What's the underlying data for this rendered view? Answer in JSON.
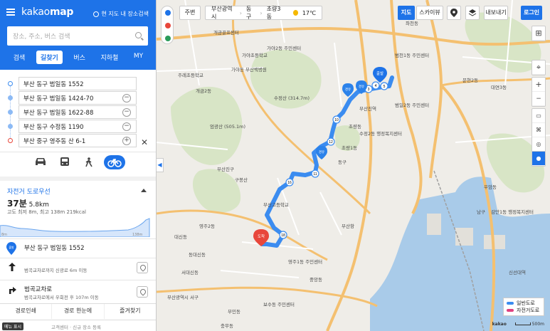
{
  "app": {
    "logo_prefix": "kakao",
    "logo_suffix": "map",
    "search_here": "현 지도 내 장소검색"
  },
  "search": {
    "placeholder": "장소, 주소, 버스 검색"
  },
  "tabs": [
    {
      "label": "검색",
      "active": false
    },
    {
      "label": "길찾기",
      "active": true
    },
    {
      "label": "버스",
      "active": false
    },
    {
      "label": "지하철",
      "active": false
    },
    {
      "label": "MY",
      "active": false
    }
  ],
  "waypoints": [
    {
      "label": "부산 동구 범일동 1552",
      "type": "start"
    },
    {
      "label": "부산 동구 범일동 1424-70",
      "type": "mid"
    },
    {
      "label": "부산 동구 범일동 1622-88",
      "type": "mid"
    },
    {
      "label": "부산 동구 수정동 1190",
      "type": "mid"
    },
    {
      "label": "부산 중구 영주동 산 6-1",
      "type": "end"
    }
  ],
  "waypoint_remove": "−",
  "waypoint_add": "+",
  "close_symbol": "✕",
  "modes": [
    {
      "name": "car",
      "active": false
    },
    {
      "name": "bus",
      "active": false
    },
    {
      "name": "walk",
      "active": false
    },
    {
      "name": "bike",
      "active": true
    }
  ],
  "route": {
    "title": "자전거 도로우선",
    "time_value": "37",
    "time_unit": "분",
    "distance": "5.8km",
    "meta": "고도 최저 8m, 최고 138m  219kcal",
    "elev_min_label": "8m",
    "elev_max_label": "138m"
  },
  "steps": [
    {
      "badge": "출발",
      "title": "부산 동구 범일동 1552",
      "sub": ""
    },
    {
      "badge": "1",
      "title": "",
      "sub": "범곡교차로까지 신광로 6m 이동"
    },
    {
      "badge": "2",
      "title": "범곡교차로",
      "sub": "범곡교차로에서 우회전 후 107m 이동"
    }
  ],
  "bottom_bar": [
    "경로인쇄",
    "경로 한눈에",
    "즐겨찾기"
  ],
  "footer": {
    "ad": "메뉴 표시",
    "links": "고객센터 · 신규 장소 등록"
  },
  "map": {
    "nearby": "주변",
    "breadcrumb": [
      "부산광역시",
      "동구",
      "초량3동"
    ],
    "weather": "17℃",
    "view_map": "지도",
    "view_sky": "스카이뷰",
    "export": "내보내기",
    "login": "로그인",
    "start_pin": "출발",
    "end_pin": "도착",
    "via_pins": [
      "경유",
      "경유",
      "경유"
    ],
    "route_markers": [
      "3",
      "4",
      "5",
      "10",
      "12",
      "11",
      "16",
      "18"
    ],
    "legend": [
      {
        "label": "일반도로",
        "color": "#3b8cf0"
      },
      {
        "label": "자전거도로",
        "color": "#e0407f"
      }
    ],
    "scale": "500m",
    "brand": "kakao",
    "labels": [
      "개금골프센터",
      "가야2동 주민센터",
      "가야초등학교",
      "가야동 부산백병원",
      "주례초등학교",
      "개금2동",
      "수정산 (314.7m)",
      "엄광산 (505.1m)",
      "구봉산",
      "부산고등학교",
      "동구",
      "부산진구",
      "초량동",
      "중앙동",
      "영주1동 주민센터",
      "보수동 주민센터",
      "부민동",
      "부산항",
      "신선대역",
      "남구",
      "우암동",
      "문현2동",
      "범천1동 주민센터",
      "범일2동 주민센터",
      "좌천동",
      "수정2동 행정복지센터",
      "초량1동",
      "대연3동",
      "감만1동 행정복지센터",
      "부산진역",
      "영주2동",
      "동대신동",
      "서대신동",
      "대신동",
      "부산광역시 서구",
      "충무동"
    ],
    "route_color": "#3b8cf0"
  }
}
